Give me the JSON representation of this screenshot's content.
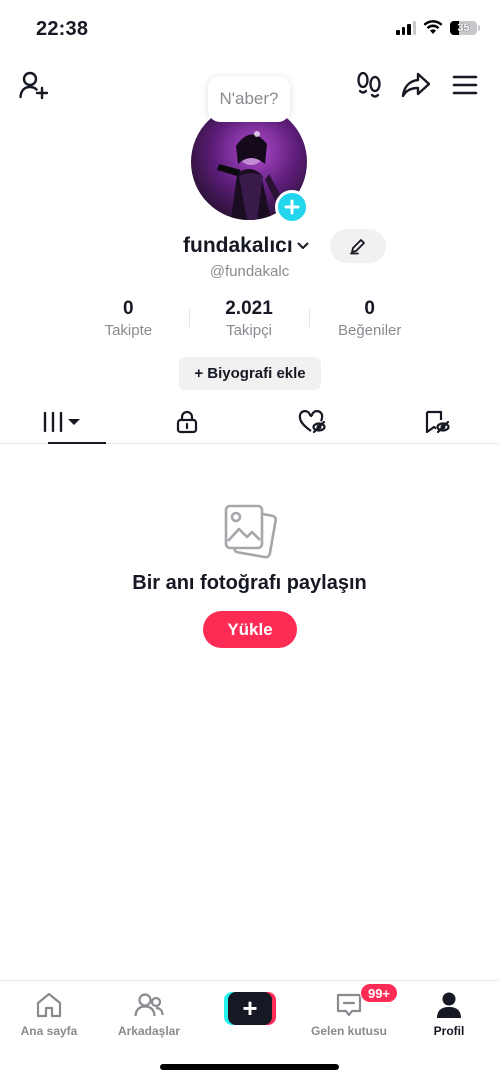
{
  "status": {
    "time": "22:38",
    "battery": "35"
  },
  "profile": {
    "bubble": "N'aber?",
    "display_name": "fundakalıcı",
    "handle": "@fundakalc",
    "stats": [
      {
        "value": "0",
        "label": "Takipte"
      },
      {
        "value": "2.021",
        "label": "Takipçi"
      },
      {
        "value": "0",
        "label": "Beğeniler"
      }
    ],
    "bio_button": "+ Biyografi ekle"
  },
  "empty_state": {
    "message": "Bir anı fotoğrafı paylaşın",
    "upload_label": "Yükle"
  },
  "bottom_nav": {
    "home": "Ana sayfa",
    "friends": "Arkadaşlar",
    "create": "+",
    "inbox": "Gelen kutusu",
    "inbox_badge": "99+",
    "profile": "Profil"
  },
  "colors": {
    "accent": "#fe2c55",
    "teal": "#20d5ec",
    "text": "#161823",
    "muted": "#8a8b91"
  }
}
